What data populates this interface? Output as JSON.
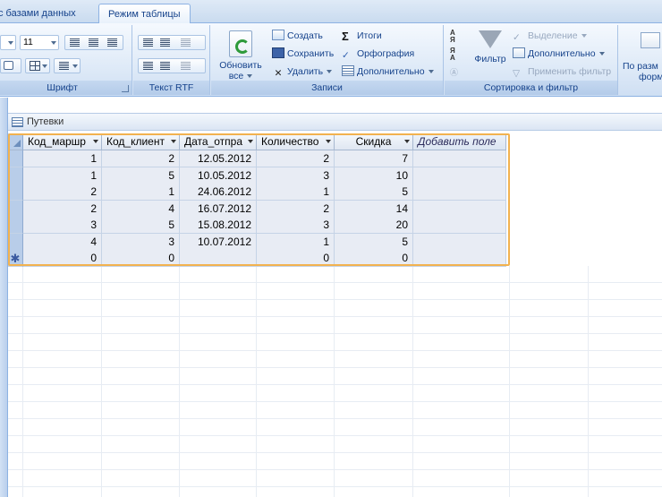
{
  "ribbon": {
    "tabs": [
      "с базами данных",
      "Режим таблицы"
    ],
    "font_group": {
      "size_value": "11",
      "footer": "Шрифт"
    },
    "rtf_group": {
      "footer": "Текст RTF"
    },
    "records_group": {
      "refresh_label": "Обновить все",
      "create": "Создать",
      "save": "Сохранить",
      "delete": "Удалить",
      "totals": "Итоги",
      "spelling": "Орфография",
      "more": "Дополнительно",
      "footer": "Записи"
    },
    "sort_group": {
      "filter": "Фильтр",
      "selection": "Выделение",
      "advanced": "Дополнительно",
      "apply_filter": "Применить фильтр",
      "footer": "Сортировка и фильтр"
    },
    "right_group": {
      "line1": "По разм",
      "line2": "форм"
    }
  },
  "document": {
    "tab_title": "Путевки"
  },
  "table": {
    "columns": [
      "Код_маршр",
      "Код_клиент",
      "Дата_отпра",
      "Количество",
      "Скидка",
      "Добавить поле"
    ],
    "rows": [
      [
        "1",
        "2",
        "12.05.2012",
        "2",
        "7"
      ],
      [
        "1",
        "5",
        "10.05.2012",
        "3",
        "10"
      ],
      [
        "2",
        "1",
        "24.06.2012",
        "1",
        "5"
      ],
      [
        "2",
        "4",
        "16.07.2012",
        "2",
        "14"
      ],
      [
        "3",
        "5",
        "15.08.2012",
        "3",
        "20"
      ],
      [
        "4",
        "3",
        "10.07.2012",
        "1",
        "5"
      ]
    ],
    "new_row": [
      "0",
      "0",
      "",
      "0",
      "0"
    ],
    "new_row_marker": "✱"
  },
  "colors": {
    "ribbon_text": "#15428b",
    "selection_border": "#f2b24f"
  }
}
